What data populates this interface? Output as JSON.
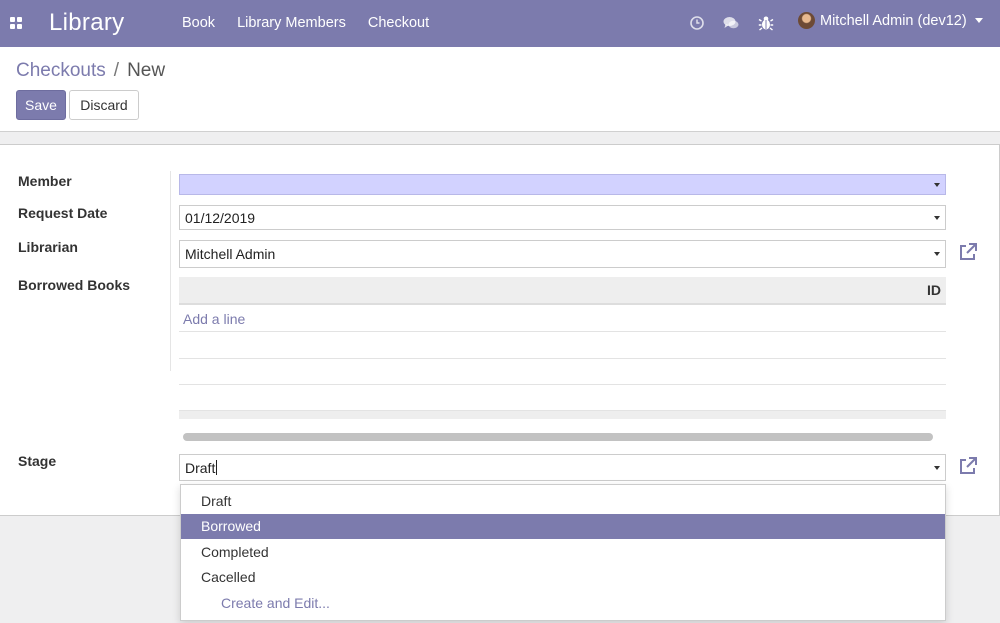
{
  "navbar": {
    "brand": "Library",
    "menu": [
      "Book",
      "Library Members",
      "Checkout"
    ],
    "user": "Mitchell Admin (dev12)",
    "icons": [
      "apps-icon",
      "clock-icon",
      "chat-icon",
      "bug-icon"
    ]
  },
  "breadcrumb": {
    "parent": "Checkouts",
    "separator": "/",
    "current": "New"
  },
  "buttons": {
    "save": "Save",
    "discard": "Discard"
  },
  "form": {
    "member": {
      "label": "Member",
      "value": ""
    },
    "request_date": {
      "label": "Request Date",
      "value": "01/12/2019"
    },
    "librarian": {
      "label": "Librarian",
      "value": "Mitchell Admin"
    },
    "borrowed_books": {
      "label": "Borrowed Books",
      "columns": [
        "ID"
      ],
      "add_line": "Add a line"
    },
    "stage": {
      "label": "Stage",
      "value": "Draft"
    }
  },
  "stage_dropdown": {
    "options": [
      "Draft",
      "Borrowed",
      "Completed",
      "Cacelled"
    ],
    "highlighted": "Borrowed",
    "create_and_edit": "Create and Edit..."
  },
  "colors": {
    "brand": "#7c7bad",
    "highlight": "#d2d2ff"
  }
}
